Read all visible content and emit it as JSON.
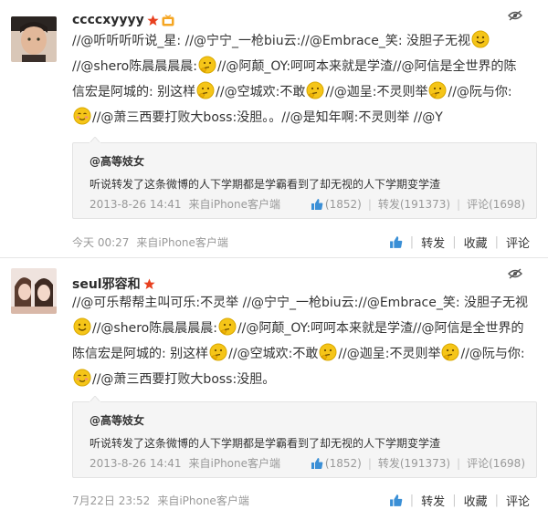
{
  "posts": [
    {
      "username": "ccccxyyyy",
      "lines": [
        [
          "//@听听听听说_星: //@宁宁_一枪biu云://@Embrace_笑: 没胆子无视",
          "smile"
        ],
        [
          "//@shero陈晨晨晨晨:",
          "think",
          "//@阿颠_OY:呵呵本来就是学渣//@阿信是全世界的陈"
        ],
        [
          "信宏是阿城的: 别这样",
          "think",
          "//@空城欢:不敢",
          "think",
          "//@迦呈:不灵则举",
          "think",
          "//@阮与你:"
        ],
        [
          "blush",
          "//@萧三西要打败大boss:没胆。。//@是知年啊:不灵则举 //@Y"
        ]
      ],
      "quote": {
        "author": "@高等妓女",
        "text": "听说转发了这条微博的人下学期都是学霸看到了却无视的人下学期变学渣",
        "time": "2013-8-26 14:41",
        "client": "来自iPhone客户端",
        "likes": "(1852)",
        "reposts": "转发(191373)",
        "comments": "评论(1698)"
      },
      "time": "今天 00:27",
      "client": "来自iPhone客户端",
      "repost_label": "转发",
      "fav_label": "收藏",
      "comment_label": "评论"
    },
    {
      "username": "seul邪容和",
      "lines": [
        [
          "//@可乐帮帮主叫可乐:不灵举 //@宁宁_一枪biu云://@Embrace_笑: 没胆子无视"
        ],
        [
          "smile",
          "//@shero陈晨晨晨晨:",
          "think",
          "//@阿颠_OY:呵呵本来就是学渣//@阿信是全世界的"
        ],
        [
          "陈信宏是阿城的: 别这样",
          "think",
          "//@空城欢:不敢",
          "think",
          "//@迦呈:不灵则举",
          "think",
          "//@阮与你:"
        ],
        [
          "blush",
          "//@萧三西要打败大boss:没胆。"
        ]
      ],
      "quote": {
        "author": "@高等妓女",
        "text": "听说转发了这条微博的人下学期都是学霸看到了却无视的人下学期变学渣",
        "time": "2013-8-26 14:41",
        "client": "来自iPhone客户端",
        "likes": "(1852)",
        "reposts": "转发(191373)",
        "comments": "评论(1698)"
      },
      "time": "7月22日 23:52",
      "client": "来自iPhone客户端",
      "repost_label": "转发",
      "fav_label": "收藏",
      "comment_label": "评论"
    }
  ],
  "icons": {
    "hide": "eye-hide-icon",
    "star": "star-badge-icon",
    "tv": "tv-badge-icon",
    "like": "thumbs-up-icon",
    "emoji_smile": "smile-emoji-icon",
    "emoji_think": "thinking-emoji-icon",
    "emoji_blush": "blush-emoji-icon"
  },
  "colors": {
    "text": "#333333",
    "meta": "#999999",
    "quote_bg": "#f5f5f5",
    "star": "#e8401f",
    "like": "#3a8fd6",
    "emoji": "#f5c518"
  }
}
